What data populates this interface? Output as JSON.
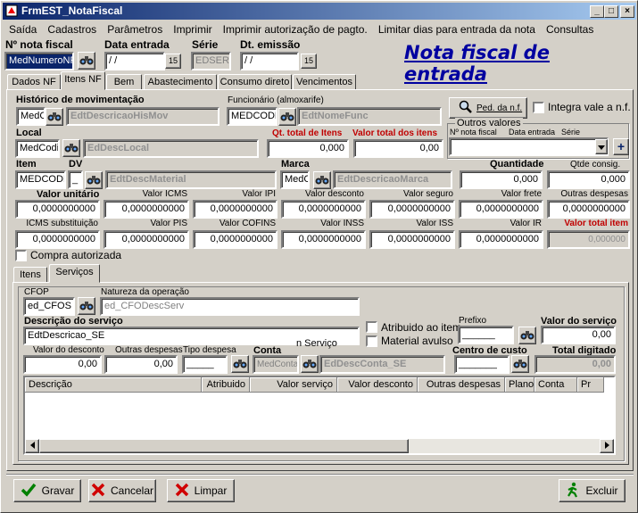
{
  "window": {
    "title": "FrmEST_NotaFiscal",
    "minimize": "_",
    "maximize": "□",
    "close": "×"
  },
  "menu": [
    "Saída",
    "Cadastros",
    "Parâmetros",
    "Imprimir",
    "Imprimir autorização de pagto.",
    "Limitar dias para entrada da nota",
    "Consultas"
  ],
  "header": {
    "nota_label": "Nº nota fiscal",
    "nota_value": "MedNumeroNF",
    "data_entrada_label": "Data entrada",
    "data_entrada_value": " / /",
    "serie_label": "Série",
    "serie_value": "EDSERI",
    "emissao_label": "Dt. emissão",
    "emissao_value": " / /",
    "cal_icon": "15",
    "page_title": "Nota fiscal de entrada"
  },
  "top_tabs": [
    "Dados NF",
    "Itens NF",
    "Bem",
    "Abastecimento",
    "Consumo direto",
    "Vencimentos"
  ],
  "itens": {
    "hist_label": "Histórico de movimentação",
    "hist_code": "MedC",
    "hist_desc": "EdtDescricaoHisMov",
    "func_label": "Funcionário (almoxarife)",
    "func_code": "MEDCODF",
    "func_desc": "EdtNomeFunc",
    "ped_btn": "Ped. da n.f.",
    "integra_label": "Integra vale a n.f.",
    "outros_label": "Outros valores",
    "outros_nota": "Nº nota fiscal",
    "outros_data": "Data entrada",
    "outros_serie": "Série",
    "plus": "+",
    "local_label": "Local",
    "local_code": "MedCodig",
    "local_desc": "EdDescLocal",
    "qt_total_label": "Qt. total de Itens",
    "qt_total_value": "0,000",
    "valor_total_label": "Valor total dos itens",
    "valor_total_value": "0,00",
    "item_label": "Item",
    "dv_label": "DV",
    "item_code": "MEDCODIG",
    "dv_value": "_",
    "item_desc": "EdtDescMaterial",
    "marca_label": "Marca",
    "marca_code": "MedC",
    "marca_desc": "EdtDescricaoMarca",
    "quantidade_label": "Quantidade",
    "quantidade_value": "0,000",
    "qtde_consig_label": "Qtde consig.",
    "qtde_consig_value": "0,000",
    "row1": [
      {
        "label": "Valor unitário",
        "value": "0,0000000000",
        "bold": true
      },
      {
        "label": "Valor ICMS",
        "value": "0,0000000000"
      },
      {
        "label": "Valor IPI",
        "value": "0,0000000000"
      },
      {
        "label": "Valor desconto",
        "value": "0,0000000000"
      },
      {
        "label": "Valor seguro",
        "value": "0,0000000000"
      },
      {
        "label": "Valor frete",
        "value": "0,0000000000"
      },
      {
        "label": "Outras despesas",
        "value": "0,0000000000"
      }
    ],
    "row2": [
      {
        "label": "ICMS substituição",
        "value": "0,0000000000"
      },
      {
        "label": "Valor PIS",
        "value": "0,0000000000"
      },
      {
        "label": "Valor COFINS",
        "value": "0,0000000000"
      },
      {
        "label": "Valor INSS",
        "value": "0,0000000000"
      },
      {
        "label": "Valor ISS",
        "value": "0,0000000000"
      },
      {
        "label": "Valor IR",
        "value": "0,0000000000"
      },
      {
        "label": "Valor total item",
        "value": "0,000000"
      }
    ],
    "compra_label": "Compra autorizada"
  },
  "sub_tabs": [
    "Itens",
    "Serviços"
  ],
  "servicos": {
    "cfop_label": "CFOP",
    "cfop_value": "ed_CFOS",
    "natureza_label": "Natureza da operação",
    "natureza_value": "ed_CFODescServ",
    "desc_label": "Descrição do serviço",
    "desc_value": "EdtDescricao_SE",
    "atribuido_label": "Atribuido ao item",
    "material_label": "Material avulso",
    "prefixo_label": "Prefixo",
    "prefixo_value": "______",
    "valor_servico_label": "Valor do serviço",
    "valor_servico_value": "0,00",
    "valor_desconto_label": "Valor do desconto",
    "valor_desconto_value": "0,00",
    "outras_label": "Outras despesas",
    "outras_value": "0,00",
    "tipo_label": "Tipo despesa",
    "tipo_value": "_____",
    "conta_label": "Conta",
    "conta_code": "MedConta",
    "conta_desc": "EdDescConta_SE",
    "hidden_label": "n Serviço",
    "centro_label": "Centro de custo",
    "centro_value": "_______",
    "total_label": "Total digitado",
    "total_value": "0,00",
    "grid_headers": [
      "Descrição",
      "Atribuido",
      "Valor serviço",
      "Valor desconto",
      "Outras despesas",
      "Plano",
      "Conta",
      "Pr"
    ]
  },
  "buttons": {
    "gravar": "Gravar",
    "cancelar": "Cancelar",
    "limpar": "Limpar",
    "excluir": "Excluir"
  }
}
